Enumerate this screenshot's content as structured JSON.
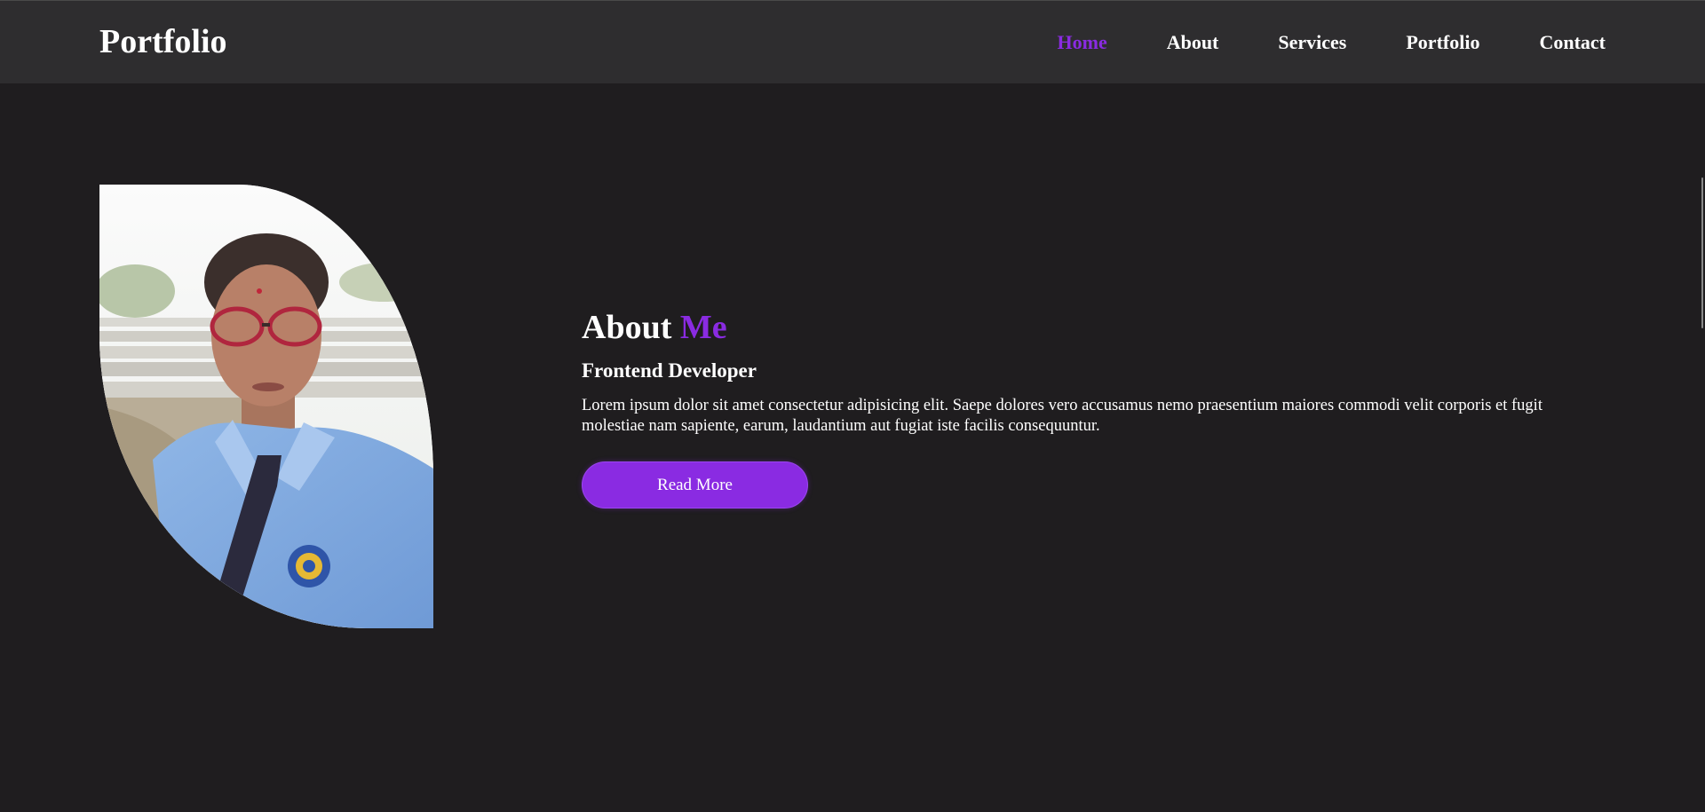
{
  "header": {
    "logo": "Portfolio",
    "nav": [
      {
        "label": "Home",
        "active": true
      },
      {
        "label": "About",
        "active": false
      },
      {
        "label": "Services",
        "active": false
      },
      {
        "label": "Portfolio",
        "active": false
      },
      {
        "label": "Contact",
        "active": false
      }
    ]
  },
  "about": {
    "title_main": "About",
    "title_accent": "Me",
    "subtitle": "Frontend Developer",
    "description": "Lorem ipsum dolor sit amet consectetur adipisicing elit. Saepe dolores vero accusamus nemo praesentium maiores commodi velit corporis et fugit molestiae nam sapiente, earum, laudantium aut fugiat iste facilis consequuntur.",
    "button_label": "Read More",
    "photo_alt": "profile photo"
  },
  "colors": {
    "accent": "#8a2be2",
    "background": "#1f1d1f",
    "header_bg": "#2e2d2f",
    "text": "#ffffff"
  }
}
